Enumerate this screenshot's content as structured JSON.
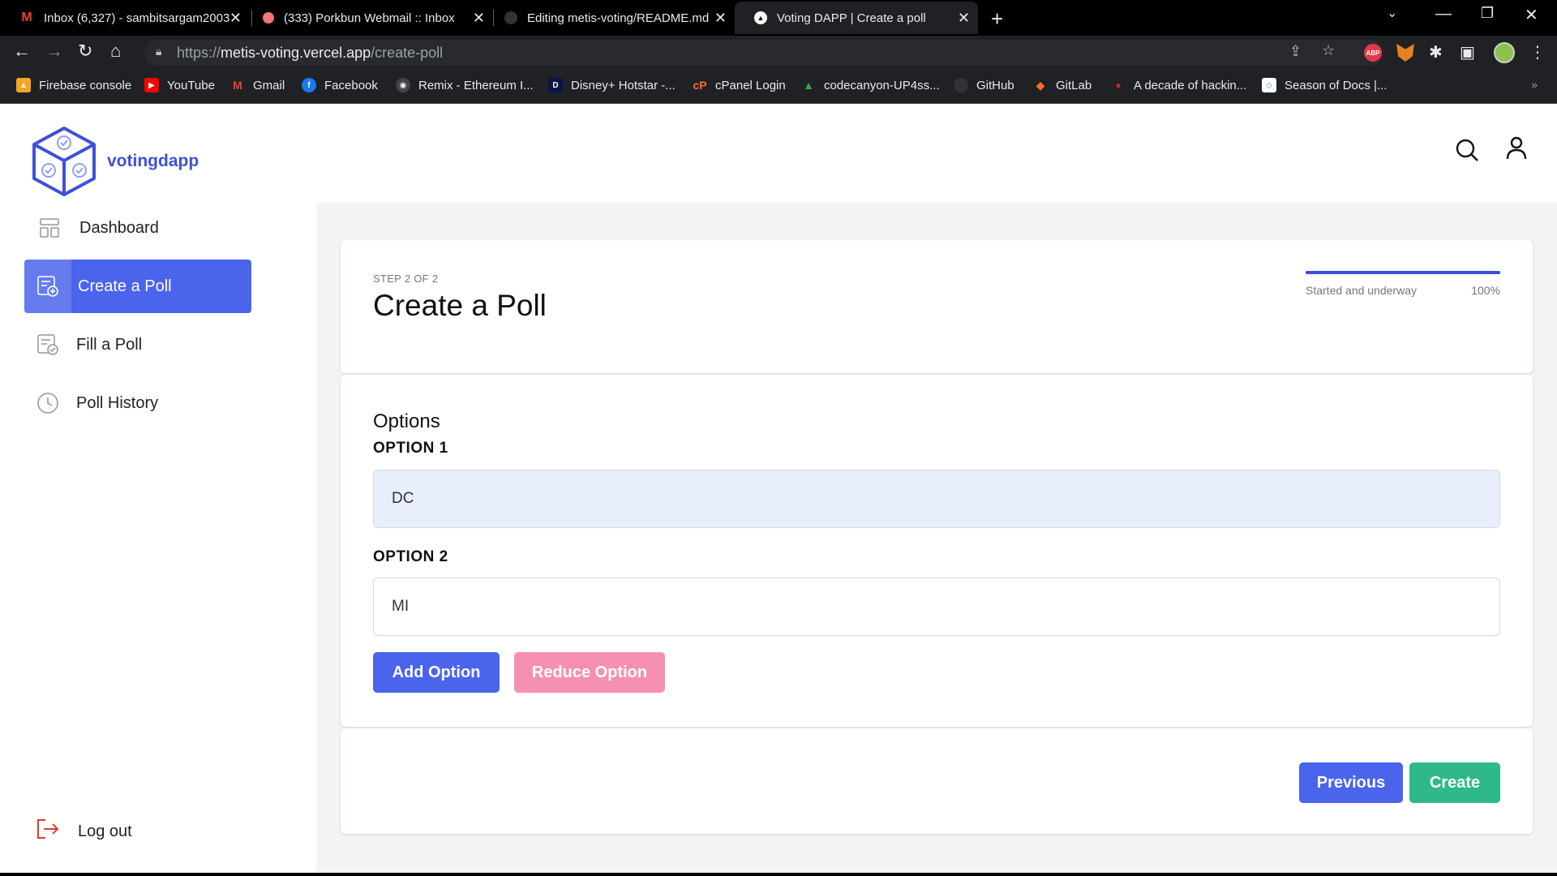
{
  "browser": {
    "tabs": [
      {
        "label": "Inbox (6,327) - sambitsargam2003",
        "favicon": "gmail-icon",
        "active": false
      },
      {
        "label": "(333) Porkbun Webmail :: Inbox",
        "favicon": "porkbun-icon",
        "active": false
      },
      {
        "label": "Editing metis-voting/README.md",
        "favicon": "github-icon",
        "active": false
      },
      {
        "label": "Voting DAPP | Create a poll",
        "favicon": "vercel-icon",
        "active": true
      }
    ],
    "url_scheme": "https://",
    "url_host": "metis-voting.vercel.app",
    "url_path": "/create-poll",
    "bookmarks": [
      {
        "label": "Firebase console",
        "icon": "firebase-icon",
        "color": "#f5a623"
      },
      {
        "label": "YouTube",
        "icon": "youtube-icon",
        "color": "#ff0000"
      },
      {
        "label": "Gmail",
        "icon": "gmail-icon",
        "color": "#ea4335"
      },
      {
        "label": "Facebook",
        "icon": "facebook-icon",
        "color": "#1877f2"
      },
      {
        "label": "Remix - Ethereum I...",
        "icon": "remix-icon",
        "color": "#555"
      },
      {
        "label": "Disney+ Hotstar -...",
        "icon": "hotstar-icon",
        "color": "#0c1446"
      },
      {
        "label": "cPanel Login",
        "icon": "cpanel-icon",
        "color": "#ff6c2c"
      },
      {
        "label": "codecanyon-UP4ss...",
        "icon": "drive-icon",
        "color": "#34a853"
      },
      {
        "label": "GitHub",
        "icon": "github-icon",
        "color": "#333"
      },
      {
        "label": "GitLab",
        "icon": "gitlab-icon",
        "color": "#fc6d26"
      },
      {
        "label": "A decade of hackin...",
        "icon": "article-icon",
        "color": "#c62828"
      },
      {
        "label": "Season of Docs |...",
        "icon": "docs-icon",
        "color": "#4285f4"
      }
    ],
    "extensions": {
      "abp": "ABP"
    }
  },
  "app": {
    "brand": "votingdapp",
    "nav": [
      {
        "label": "Dashboard",
        "icon": "dashboard-icon",
        "active": false
      },
      {
        "label": "Create a Poll",
        "icon": "create-poll-icon",
        "active": true
      },
      {
        "label": "Fill a Poll",
        "icon": "fill-poll-icon",
        "active": false
      },
      {
        "label": "Poll History",
        "icon": "history-icon",
        "active": false
      }
    ],
    "logout": "Log out"
  },
  "form": {
    "step": "STEP 2 OF 2",
    "title": "Create a Poll",
    "progress_status": "Started and underway",
    "progress_percent": "100%",
    "progress_value": 1.0,
    "section_title": "Options",
    "options": [
      {
        "label": "OPTION 1",
        "value": "DC"
      },
      {
        "label": "OPTION 2",
        "value": "MI"
      }
    ],
    "add_option": "Add Option",
    "reduce_option": "Reduce Option",
    "previous": "Previous",
    "create": "Create"
  },
  "colors": {
    "accent": "#4a64ec",
    "create_button": "#2fb98a",
    "reduce_button": "#f590b3"
  }
}
